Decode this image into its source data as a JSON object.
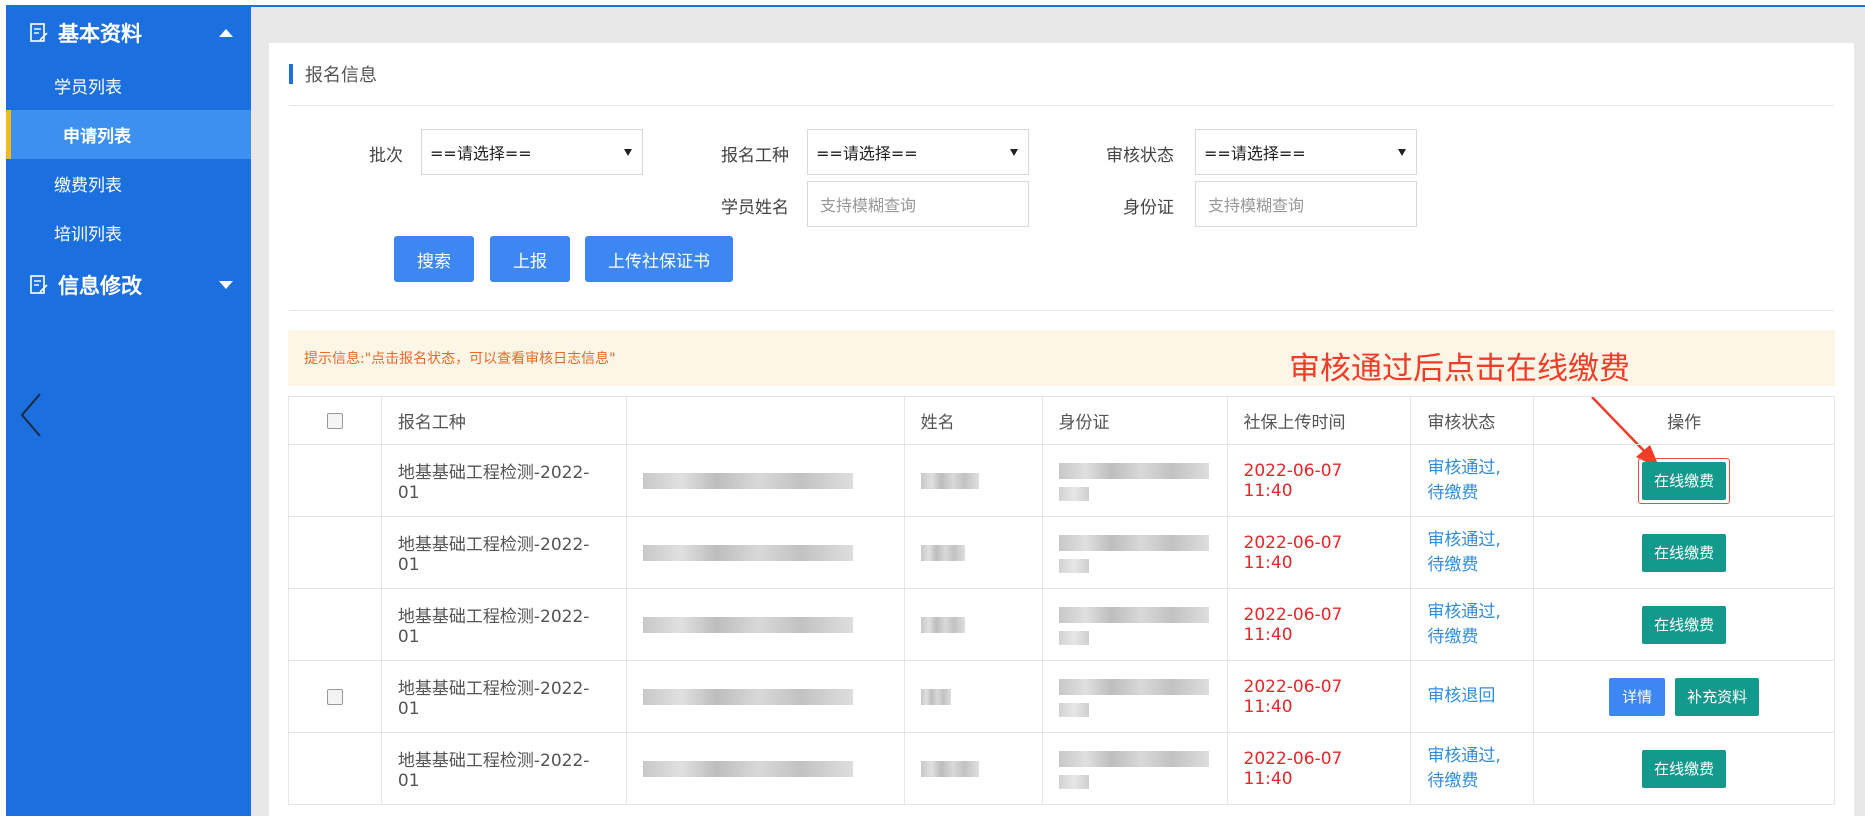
{
  "sidebar": {
    "groups": [
      {
        "label": "基本资料",
        "expanded": true
      },
      {
        "label": "信息修改",
        "expanded": false
      }
    ],
    "items": [
      {
        "label": "学员列表"
      },
      {
        "label": "申请列表",
        "active": true
      },
      {
        "label": "缴费列表"
      },
      {
        "label": "培训列表"
      }
    ]
  },
  "panel": {
    "title": "报名信息"
  },
  "filters": {
    "batch_label": "批次",
    "batch_value": "==请选择==",
    "job_label": "报名工种",
    "job_value": "==请选择==",
    "status_label": "审核状态",
    "status_value": "==请选择==",
    "name_label": "学员姓名",
    "name_placeholder": "支持模糊查询",
    "id_label": "身份证",
    "id_placeholder": "支持模糊查询"
  },
  "buttons": {
    "search": "搜索",
    "report": "上报",
    "upload": "上传社保证书"
  },
  "notice": "提示信息:\"点击报名状态，可以查看审核日志信息\"",
  "annotation": "审核通过后点击在线缴费",
  "table": {
    "headers": [
      "报名工种",
      "",
      "姓名",
      "身份证",
      "社保上传时间",
      "审核状态",
      "操作"
    ],
    "rows": [
      {
        "job": "地基基础工程检测-2022-01",
        "time": "2022-06-07 11:40",
        "status_line1": "审核通过,",
        "status_line2": "待缴费",
        "action": "在线缴费"
      },
      {
        "job": "地基基础工程检测-2022-01",
        "time": "2022-06-07 11:40",
        "status_line1": "审核通过,",
        "status_line2": "待缴费",
        "action": "在线缴费"
      },
      {
        "job": "地基基础工程检测-2022-01",
        "time": "2022-06-07 11:40",
        "status_line1": "审核通过,",
        "status_line2": "待缴费",
        "action": "在线缴费"
      },
      {
        "job": "地基基础工程检测-2022-01",
        "time": "2022-06-07 11:40",
        "status_line1": "审核退回",
        "status_line2": "",
        "action_detail": "详情",
        "action_supplement": "补充资料"
      },
      {
        "job": "地基基础工程检测-2022-01",
        "time": "2022-06-07 11:40",
        "status_line1": "审核通过,",
        "status_line2": "待缴费",
        "action": "在线缴费"
      }
    ]
  },
  "colors": {
    "sidebar_bg": "#1c6fde",
    "active_accent": "#f5b823",
    "primary_button": "#3c87f1",
    "pay_button": "#149a8c",
    "time_text": "#e42828",
    "status_text": "#2e8ee0",
    "annotation": "#f03c28"
  }
}
